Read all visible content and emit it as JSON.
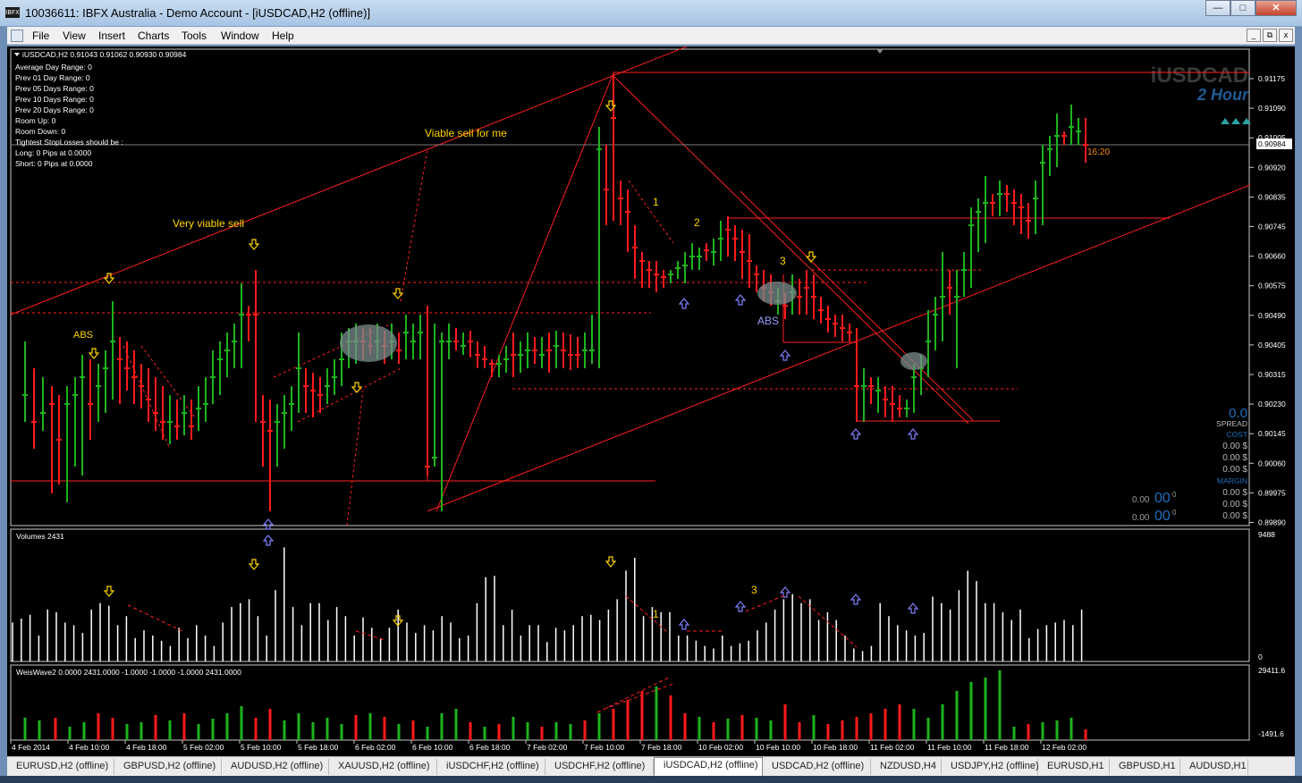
{
  "window": {
    "title": "10036611: IBFX Australia - Demo Account - [iUSDCAD,H2 (offline)]",
    "app_icon": "IBFX"
  },
  "window_controls": {
    "minimize": "—",
    "maximize": "□",
    "close": "✕"
  },
  "menu": [
    "File",
    "View",
    "Insert",
    "Charts",
    "Tools",
    "Window",
    "Help"
  ],
  "mdi_controls": {
    "minimize": "_",
    "restore": "⧉",
    "close": "x"
  },
  "chart": {
    "header": "iUSDCAD,H2  0.91043 0.91062 0.90930 0.90984",
    "info_lines": [
      "Average Day  Range: 0",
      "Prev 01  Day  Range: 0",
      "Prev 05  Days Range: 0",
      "Prev 10  Days Range: 0",
      "Prev 20  Days Range: 0",
      "Room Up:      0",
      "Room Down: 0",
      "Tightest StopLosses should be :",
      "Long:  0 Pips at 0.0000",
      "Short: 0 Pips at 0.0000"
    ],
    "watermark_symbol": "iUSDCAD",
    "watermark_period": "2 Hour",
    "current_price": "0.90984",
    "countdown": "16:20",
    "price_axis": [
      "0.91175",
      "0.91090",
      "0.91005",
      "0.90920",
      "0.90835",
      "0.90745",
      "0.90660",
      "0.90575",
      "0.90490",
      "0.90405",
      "0.90315",
      "0.90230",
      "0.90145",
      "0.90060",
      "0.89975",
      "0.89890"
    ],
    "annotations": {
      "viable_sell": "Viable sell for me",
      "very_viable_sell": "Very viable sell",
      "abs_left": "ABS",
      "abs_right": "ABS",
      "wave1": "1",
      "wave2": "2",
      "wave3": "3"
    },
    "side_panel": {
      "spread_value": "0.0",
      "spread_label": "SPREAD",
      "cost_label": "COST",
      "cost_values": [
        "0.00 $",
        "0.00 $",
        "0.00 $"
      ],
      "margin_label": "MARGIN",
      "margin_values": [
        "0.00 $",
        "0.00 $",
        "0.00 $"
      ],
      "bid_small": "0.00",
      "bid_big": "00",
      "bid_sup": "0",
      "ask_small": "0.00",
      "ask_big": "00",
      "ask_sup": "0"
    },
    "colors": {
      "bull": "#1db31d",
      "bear": "#ff1a1a",
      "line": "#ff2020",
      "text_yellow": "#ffd400",
      "arrow_blue": "#8080ff"
    }
  },
  "volumes": {
    "label": "Volumes 2431",
    "axis_top": "9488",
    "axis_bottom": "0",
    "wave1": "1",
    "wave3": "3"
  },
  "weiswave": {
    "label": "WeisWave2 0.0000 2431.0000 -1.0000 -1.0000 -1.0000 2431.0000",
    "axis_top": "29411.6",
    "axis_bottom": "-1491.6"
  },
  "time_axis": [
    "4 Feb 2014",
    "4 Feb 10:00",
    "4 Feb 18:00",
    "5 Feb 02:00",
    "5 Feb 10:00",
    "5 Feb 18:00",
    "6 Feb 02:00",
    "6 Feb 10:00",
    "6 Feb 18:00",
    "7 Feb 02:00",
    "7 Feb 10:00",
    "7 Feb 18:00",
    "10 Feb 02:00",
    "10 Feb 10:00",
    "10 Feb 18:00",
    "11 Feb 02:00",
    "11 Feb 10:00",
    "11 Feb 18:00",
    "12 Feb 02:00"
  ],
  "tabs": [
    {
      "label": "EURUSD,H2 (offline)",
      "active": false
    },
    {
      "label": "GBPUSD,H2 (offline)",
      "active": false
    },
    {
      "label": "AUDUSD,H2 (offline)",
      "active": false
    },
    {
      "label": "XAUUSD,H2 (offline)",
      "active": false
    },
    {
      "label": "iUSDCHF,H2 (offline)",
      "active": false
    },
    {
      "label": "USDCHF,H2 (offline)",
      "active": false
    },
    {
      "label": "iUSDCAD,H2 (offline)",
      "active": true
    },
    {
      "label": "USDCAD,H2 (offline)",
      "active": false
    },
    {
      "label": "NZDUSD,H4",
      "active": false
    },
    {
      "label": "USDJPY,H2 (offline)",
      "active": false
    },
    {
      "label": "EURUSD,H1",
      "active": false
    },
    {
      "label": "GBPUSD,H1",
      "active": false
    },
    {
      "label": "AUDUSD,H1",
      "active": false
    }
  ]
}
